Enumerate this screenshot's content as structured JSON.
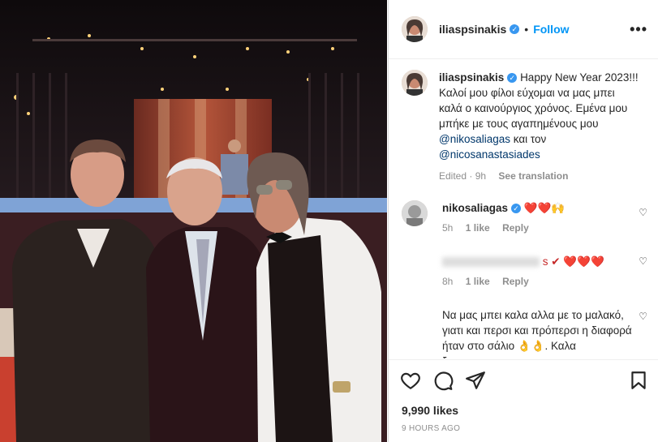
{
  "post": {
    "username": "iliaspsinakis",
    "follow_label": "Follow",
    "more_label": "•••",
    "dot": "•",
    "caption_user": "iliaspsinakis",
    "caption_line1": "Happy New Year 2023!!! Καλοί μου φίλοι εύχομαι να μας μπει καλά ο καινούργιος χρόνος. Εμένα μου μπήκε με τους αγαπημένους μου ",
    "mention1": "@nikosaliagas",
    "caption_mid": " και τον ",
    "mention2": "@nicosanastasiades",
    "edited_label": "Edited · 9h",
    "see_translation": "See translation",
    "likes": "9,990 likes",
    "time": "9 HOURS AGO"
  },
  "comments": [
    {
      "user": "nikosaliagas",
      "text": "❤️❤️🙌",
      "time": "5h",
      "likes": "1 like",
      "reply": "Reply"
    },
    {
      "user": "",
      "text": "s ✔ ❤️❤️❤️",
      "time": "8h",
      "likes": "1 like",
      "reply": "Reply"
    },
    {
      "user": "",
      "text": "Να μας μπει καλα αλλα με το μαλακό, γιατι και περσι και πρόπερσι η διαφορά ήταν στο σάλιο 👌👌. Καλα ξεμουνιασματα να",
      "time": "",
      "likes": "",
      "reply": ""
    }
  ],
  "icons": {
    "heart": "heart-icon",
    "comment": "comment-icon",
    "share": "share-icon",
    "bookmark": "bookmark-icon",
    "verified": "verified-badge-icon"
  },
  "colors": {
    "accent": "#0095f6",
    "verified": "#3897f0",
    "mention": "#00376b"
  }
}
